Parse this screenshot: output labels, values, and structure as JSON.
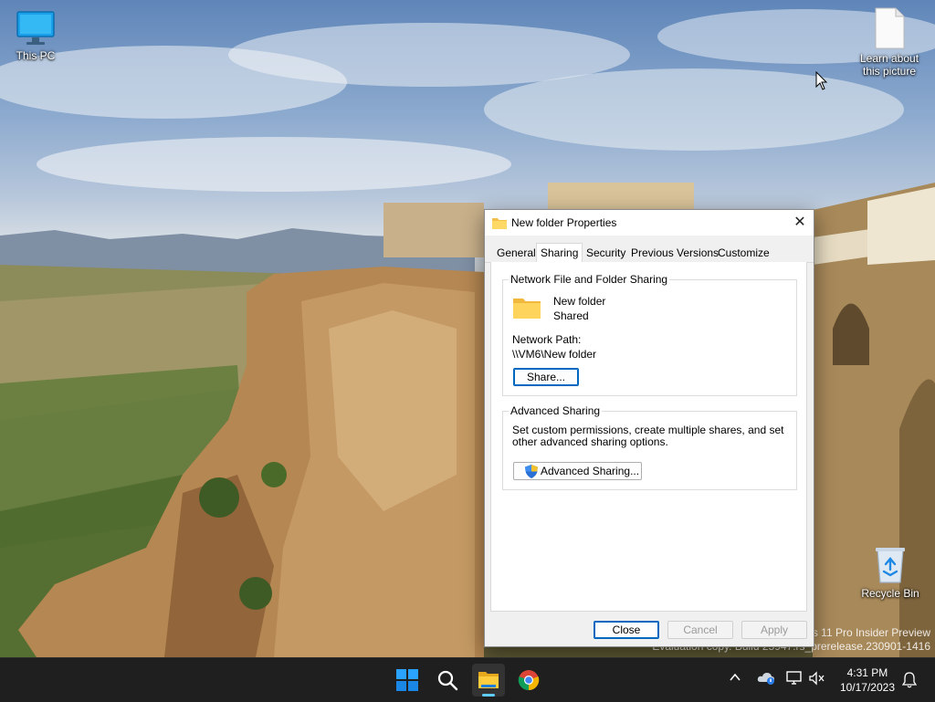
{
  "desktop": {
    "icons": {
      "this_pc": "This PC",
      "learn_picture": "Learn about\nthis picture",
      "recycle_bin": "Recycle Bin"
    },
    "watermark": {
      "line1": "ws 11 Pro Insider Preview",
      "line2": "Evaluation copy. Build 25947.rs_prerelease.230901-1416"
    }
  },
  "dialog": {
    "title": "New folder Properties",
    "tabs": [
      "General",
      "Sharing",
      "Security",
      "Previous Versions",
      "Customize"
    ],
    "active_tab": "Sharing",
    "network_sharing": {
      "group_title": "Network File and Folder Sharing",
      "folder_name": "New folder",
      "folder_state": "Shared",
      "network_path_label": "Network Path:",
      "network_path": "\\\\VM6\\New folder",
      "share_button": "Share..."
    },
    "advanced_sharing": {
      "group_title": "Advanced Sharing",
      "description": "Set custom permissions, create multiple shares, and set other advanced sharing options.",
      "button": "Advanced Sharing..."
    },
    "footer": {
      "close": "Close",
      "cancel": "Cancel",
      "apply": "Apply"
    }
  },
  "taskbar": {
    "apps": [
      "start-icon",
      "search-icon",
      "file-explorer-icon",
      "chrome-icon"
    ],
    "tray": [
      "chevron-up-icon",
      "onedrive-icon",
      "network-icon",
      "volume-muted-icon"
    ],
    "time": "4:31 PM",
    "date": "10/17/2023",
    "accent_color": "#0078d4"
  }
}
